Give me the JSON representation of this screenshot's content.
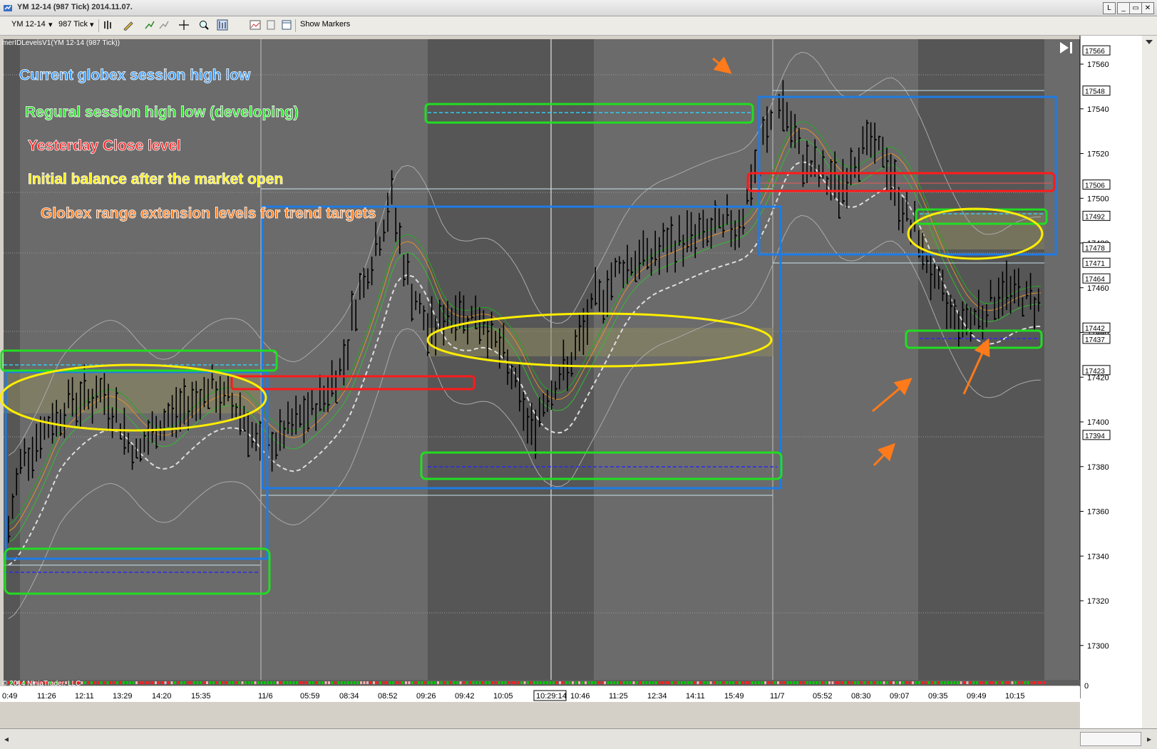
{
  "window": {
    "title": "YM 12-14 (987 Tick)  2014.11.07.",
    "min_btn": "_",
    "max_btn": "▭",
    "close_btn": "✕",
    "l_btn": "L"
  },
  "toolbar": {
    "instrument": "YM 12-14",
    "interval": "987 Tick",
    "show_markers": "Show Markers"
  },
  "chart": {
    "indicator_label": "merIDLevelsV1(YM 12-14 (987 Tick))",
    "copyright": "© 2014 NinjaTrader, LLC",
    "current_time_label": "10:29:14",
    "annotations": [
      {
        "text": "Current globex session high low",
        "color": "#3399ff"
      },
      {
        "text": "Regural session high low (developing)",
        "color": "#22dd22"
      },
      {
        "text": "Yesterday Close level",
        "color": "#ff2222"
      },
      {
        "text": "Initial balance after the market open",
        "color": "#ffee00"
      },
      {
        "text": "Globex range extension levels for trend targets",
        "color": "#ff7a1a"
      }
    ],
    "y_axis_ticks": [
      "17560",
      "17540",
      "17520",
      "17500",
      "17480",
      "17460",
      "17440",
      "17420",
      "17400",
      "17380",
      "17360",
      "17340",
      "17320",
      "17300"
    ],
    "price_labels": [
      "17566",
      "17548",
      "17506",
      "17492",
      "17478",
      "17471",
      "17464",
      "17442",
      "17437",
      "17423",
      "17394"
    ],
    "x_axis_labels": [
      "0:49",
      "11:26",
      "12:11",
      "13:29",
      "14:20",
      "15:35",
      "11/6",
      "05:59",
      "08:34",
      "08:52",
      "09:26",
      "09:42",
      "10:05",
      "10:46",
      "11:25",
      "12:34",
      "14:11",
      "15:49",
      "11/7",
      "05:52",
      "08:30",
      "09:07",
      "09:35",
      "09:49",
      "10:15"
    ],
    "volume_zero_label": "0",
    "colors": {
      "background": "#6b6b6b",
      "dark_band": "#565656",
      "bar": "#000000",
      "box_blue": "#1e7be6",
      "box_green": "#22dd22",
      "box_red": "#ff1a1a",
      "ellipse_yellow": "#ffee00",
      "arrow_orange": "#ff7a1a"
    }
  }
}
